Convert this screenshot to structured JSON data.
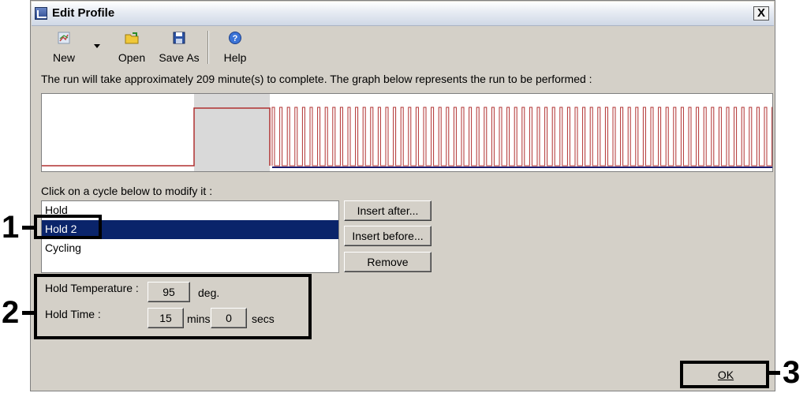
{
  "window": {
    "title": "Edit Profile",
    "close_label": "X"
  },
  "toolbar": {
    "new_label": "New",
    "open_label": "Open",
    "save_as_label": "Save As",
    "help_label": "Help"
  },
  "duration_text": "The run will take approximately 209 minute(s) to complete. The graph below represents the run to be performed :",
  "cycle_prompt": "Click on a cycle below to modify it :",
  "cycles": [
    {
      "label": "Hold",
      "selected": false
    },
    {
      "label": "Hold 2",
      "selected": true
    },
    {
      "label": "Cycling",
      "selected": false
    }
  ],
  "buttons": {
    "insert_after": "Insert after...",
    "insert_before": "Insert before...",
    "remove": "Remove",
    "ok": "OK"
  },
  "hold": {
    "temp_label": "Hold Temperature :",
    "temp_value": "95",
    "temp_unit": "deg.",
    "time_label": "Hold Time :",
    "mins_value": "15",
    "mins_unit": "mins",
    "secs_value": "0",
    "secs_unit": "secs"
  },
  "callouts": [
    "1",
    "2",
    "3"
  ],
  "colors": {
    "selection": "#0a246a",
    "graph_line": "#b03030",
    "graph_dark": "#1a1a6e",
    "dialog_bg": "#d4d0c8"
  },
  "icons": [
    "new-icon",
    "open-icon",
    "save-icon",
    "help-icon",
    "app-icon",
    "close-icon"
  ]
}
